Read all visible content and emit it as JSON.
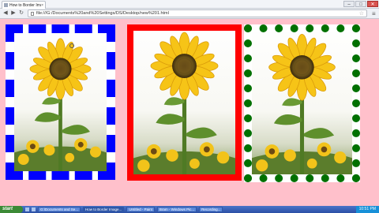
{
  "browser": {
    "tab_title": "How to Border Images",
    "url": "file:///G:/Documents%20and%20Settings/DS/Desktop/new%201.html",
    "window_buttons": {
      "minimize": "–",
      "maximize": "□",
      "close": "✕"
    },
    "tab_close": "×"
  },
  "frames": [
    {
      "border_style": "dashed",
      "border_color": "#0000ff"
    },
    {
      "border_style": "solid",
      "border_color": "#ff0000"
    },
    {
      "border_style": "dotted",
      "border_color": "#007000"
    }
  ],
  "taskbar": {
    "start_label": "start",
    "tasks": [
      {
        "label": "G:\\Documents and Se..."
      },
      {
        "label": "How to Border Image..."
      },
      {
        "label": "Untitled - Paint"
      },
      {
        "label": "Bram - Windows Pic..."
      },
      {
        "label": "Recording..."
      }
    ],
    "clock": "10:51 PM"
  }
}
